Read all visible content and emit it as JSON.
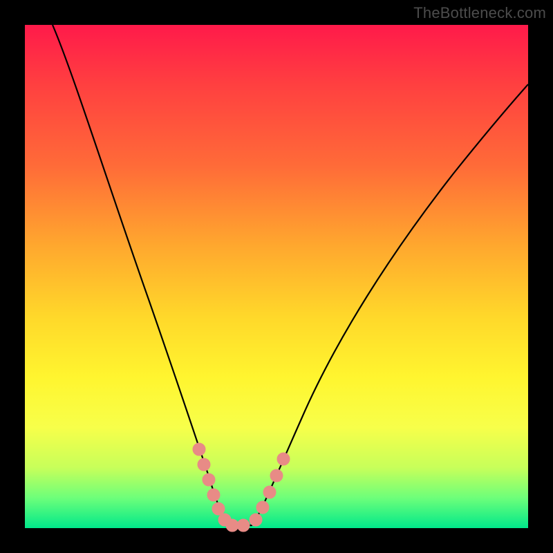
{
  "attribution": "TheBottleneck.com",
  "colors": {
    "background": "#000000",
    "gradient_top": "#ff1a4a",
    "gradient_mid1": "#ffa82e",
    "gradient_mid2": "#fff52f",
    "gradient_bottom": "#00e88a",
    "curve": "#000000",
    "beads": "#e88b86"
  },
  "chart_data": {
    "type": "line",
    "title": "",
    "xlabel": "",
    "ylabel": "",
    "xlim": [
      0,
      100
    ],
    "ylim": [
      0,
      100
    ],
    "grid": false,
    "legend": false,
    "series": [
      {
        "name": "bottleneck-curve",
        "x": [
          5,
          10,
          15,
          20,
          25,
          28,
          30,
          33,
          36,
          38,
          40,
          43,
          47,
          52,
          58,
          64,
          72,
          80,
          88,
          96,
          100
        ],
        "values": [
          100,
          88,
          75,
          61,
          44,
          33,
          26,
          16,
          6,
          2,
          0,
          0,
          3,
          10,
          20,
          30,
          42,
          52,
          61,
          69,
          72
        ]
      }
    ],
    "annotations": {
      "beads_left_cluster_x_range": [
        34,
        38
      ],
      "beads_right_cluster_x_range": [
        45,
        50
      ],
      "beads_y_range": [
        0,
        16
      ]
    }
  }
}
